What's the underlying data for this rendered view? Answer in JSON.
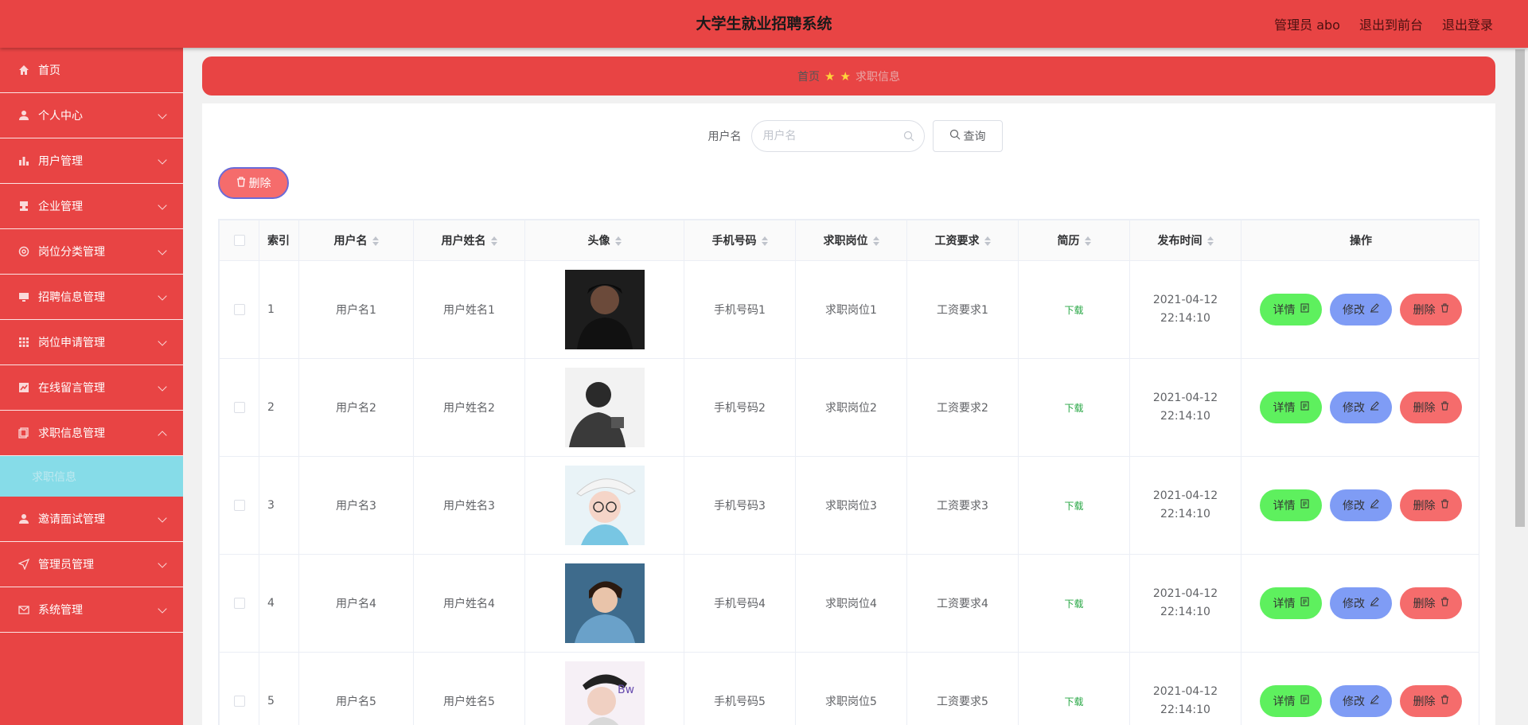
{
  "header": {
    "title": "大学生就业招聘系统",
    "user": "管理员 abo",
    "to_front": "退出到前台",
    "logout": "退出登录"
  },
  "sidebar": {
    "items": [
      {
        "label": "首页",
        "icon": "home-icon"
      },
      {
        "label": "个人中心",
        "icon": "user-icon"
      },
      {
        "label": "用户管理",
        "icon": "bar-chart-icon"
      },
      {
        "label": "企业管理",
        "icon": "stamp-icon"
      },
      {
        "label": "岗位分类管理",
        "icon": "gear-icon"
      },
      {
        "label": "招聘信息管理",
        "icon": "monitor-icon"
      },
      {
        "label": "岗位申请管理",
        "icon": "grid-icon"
      },
      {
        "label": "在线留言管理",
        "icon": "chart-box-icon"
      },
      {
        "label": "求职信息管理",
        "icon": "document-icon"
      },
      {
        "label": "邀请面试管理",
        "icon": "user-icon"
      },
      {
        "label": "管理员管理",
        "icon": "send-icon"
      },
      {
        "label": "系统管理",
        "icon": "mail-icon"
      }
    ],
    "active_sub": "求职信息"
  },
  "breadcrumb": {
    "home": "首页",
    "current": "求职信息"
  },
  "search": {
    "label": "用户名",
    "placeholder": "用户名",
    "button": "查询"
  },
  "actions": {
    "delete": "删除"
  },
  "table": {
    "headers": [
      "索引",
      "用户名",
      "用户姓名",
      "头像",
      "手机号码",
      "求职岗位",
      "工资要求",
      "简历",
      "发布时间",
      "操作"
    ],
    "rows": [
      {
        "index": "1",
        "username": "用户名1",
        "realname": "用户姓名1",
        "phone": "手机号码1",
        "position": "求职岗位1",
        "salary": "工资要求1",
        "resume": "下载",
        "time": "2021-04-12 22:14:10"
      },
      {
        "index": "2",
        "username": "用户名2",
        "realname": "用户姓名2",
        "phone": "手机号码2",
        "position": "求职岗位2",
        "salary": "工资要求2",
        "resume": "下载",
        "time": "2021-04-12 22:14:10"
      },
      {
        "index": "3",
        "username": "用户名3",
        "realname": "用户姓名3",
        "phone": "手机号码3",
        "position": "求职岗位3",
        "salary": "工资要求3",
        "resume": "下载",
        "time": "2021-04-12 22:14:10"
      },
      {
        "index": "4",
        "username": "用户名4",
        "realname": "用户姓名4",
        "phone": "手机号码4",
        "position": "求职岗位4",
        "salary": "工资要求4",
        "resume": "下载",
        "time": "2021-04-12 22:14:10"
      },
      {
        "index": "5",
        "username": "用户名5",
        "realname": "用户姓名5",
        "phone": "手机号码5",
        "position": "求职岗位5",
        "salary": "工资要求5",
        "resume": "下载",
        "time": "2021-04-12 22:14:10"
      }
    ],
    "op_labels": {
      "detail": "详情",
      "edit": "修改",
      "delete": "删除"
    }
  },
  "colors": {
    "brand": "#e84444",
    "detail": "#5ef05e",
    "edit": "#7f9cf5",
    "delete": "#f56c6c",
    "active_sub": "#86dce8"
  }
}
